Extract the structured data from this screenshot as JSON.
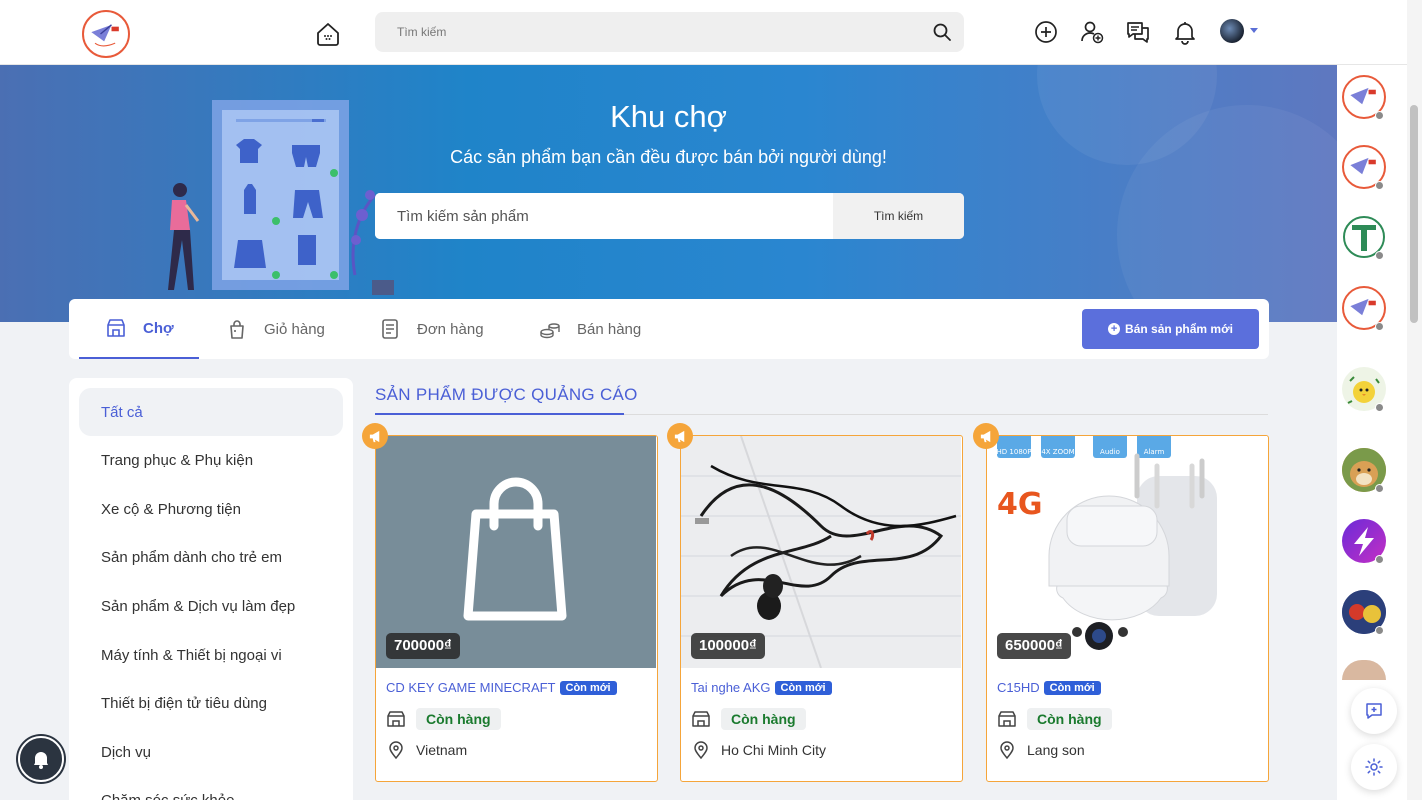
{
  "header": {
    "search_placeholder": "Tìm kiếm",
    "icons": [
      "home-icon",
      "create-icon",
      "add-friend-icon",
      "messages-icon",
      "notifications-icon"
    ]
  },
  "banner": {
    "title": "Khu chợ",
    "subtitle": "Các sản phẩm bạn cần đều được bán bởi người dùng!",
    "search_placeholder": "Tìm kiếm sản phẩm",
    "search_button": "Tìm kiếm"
  },
  "tabs": [
    {
      "label": "Chợ",
      "icon": "store-icon",
      "active": true
    },
    {
      "label": "Giỏ hàng",
      "icon": "cart-icon",
      "active": false
    },
    {
      "label": "Đơn hàng",
      "icon": "orders-icon",
      "active": false
    },
    {
      "label": "Bán hàng",
      "icon": "sell-icon",
      "active": false
    }
  ],
  "sell_button": "Bán sản phẩm mới",
  "categories": [
    "Tất cả",
    "Trang phục & Phụ kiện",
    "Xe cộ & Phương tiện",
    "Sản phẩm dành cho trẻ em",
    "Sản phẩm & Dịch vụ làm đẹp",
    "Máy tính & Thiết bị ngoại vi",
    "Thiết bị điện tử tiêu dùng",
    "Dịch vụ",
    "Chăm sóc sức khỏe"
  ],
  "section_title": "SẢN PHẨM ĐƯỢC QUẢNG CÁO",
  "products": [
    {
      "title": "CD KEY GAME MINECRAFT",
      "badge": "Còn mới",
      "price": "700000₫",
      "stock": "Còn hàng",
      "location": "Vietnam"
    },
    {
      "title": "Tai nghe AKG",
      "badge": "Còn mới",
      "price": "100000₫",
      "stock": "Còn hàng",
      "location": "Ho Chi Minh City"
    },
    {
      "title": "C15HD",
      "badge": "Còn mới",
      "price": "650000₫",
      "stock": "Còn hàng",
      "location": "Lang son"
    }
  ],
  "product3_image_labels": {
    "tags": [
      "HD 1080P",
      "4X ZOOM",
      "Audio",
      "Alarm"
    ],
    "network": "4G"
  },
  "colors": {
    "accent": "#4a5fd6",
    "promo": "#f5a53a",
    "stock_green": "#1a7a2e",
    "badge_blue": "#2f5fd8"
  }
}
